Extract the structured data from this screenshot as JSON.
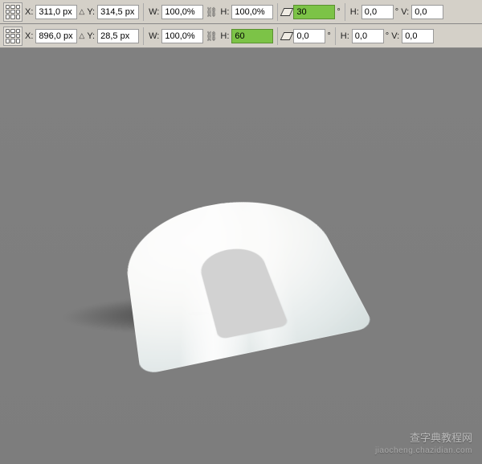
{
  "toolbar1": {
    "x_label": "X:",
    "x_value": "311,0 px",
    "y_label": "Y:",
    "y_value": "314,5 px",
    "w_label": "W:",
    "w_value": "100,0%",
    "h_label": "H:",
    "h_value": "100,0%",
    "angle_value": "30",
    "skew_h_label": "H:",
    "skew_h_value": "0,0",
    "skew_v_label": "V:",
    "skew_v_value": "0,0"
  },
  "toolbar2": {
    "x_label": "X:",
    "x_value": "896,0 px",
    "y_label": "Y:",
    "y_value": "28,5 px",
    "w_label": "W:",
    "w_value": "100,0%",
    "h_label": "H:",
    "h_value": "60",
    "angle_value": "0,0",
    "skew_h_label": "H:",
    "skew_h_value": "0,0",
    "skew_v_label": "V:",
    "skew_v_value": "0,0"
  },
  "watermark": {
    "line1": "查字典教程网",
    "line2": "jiaocheng.chazidian.com"
  }
}
